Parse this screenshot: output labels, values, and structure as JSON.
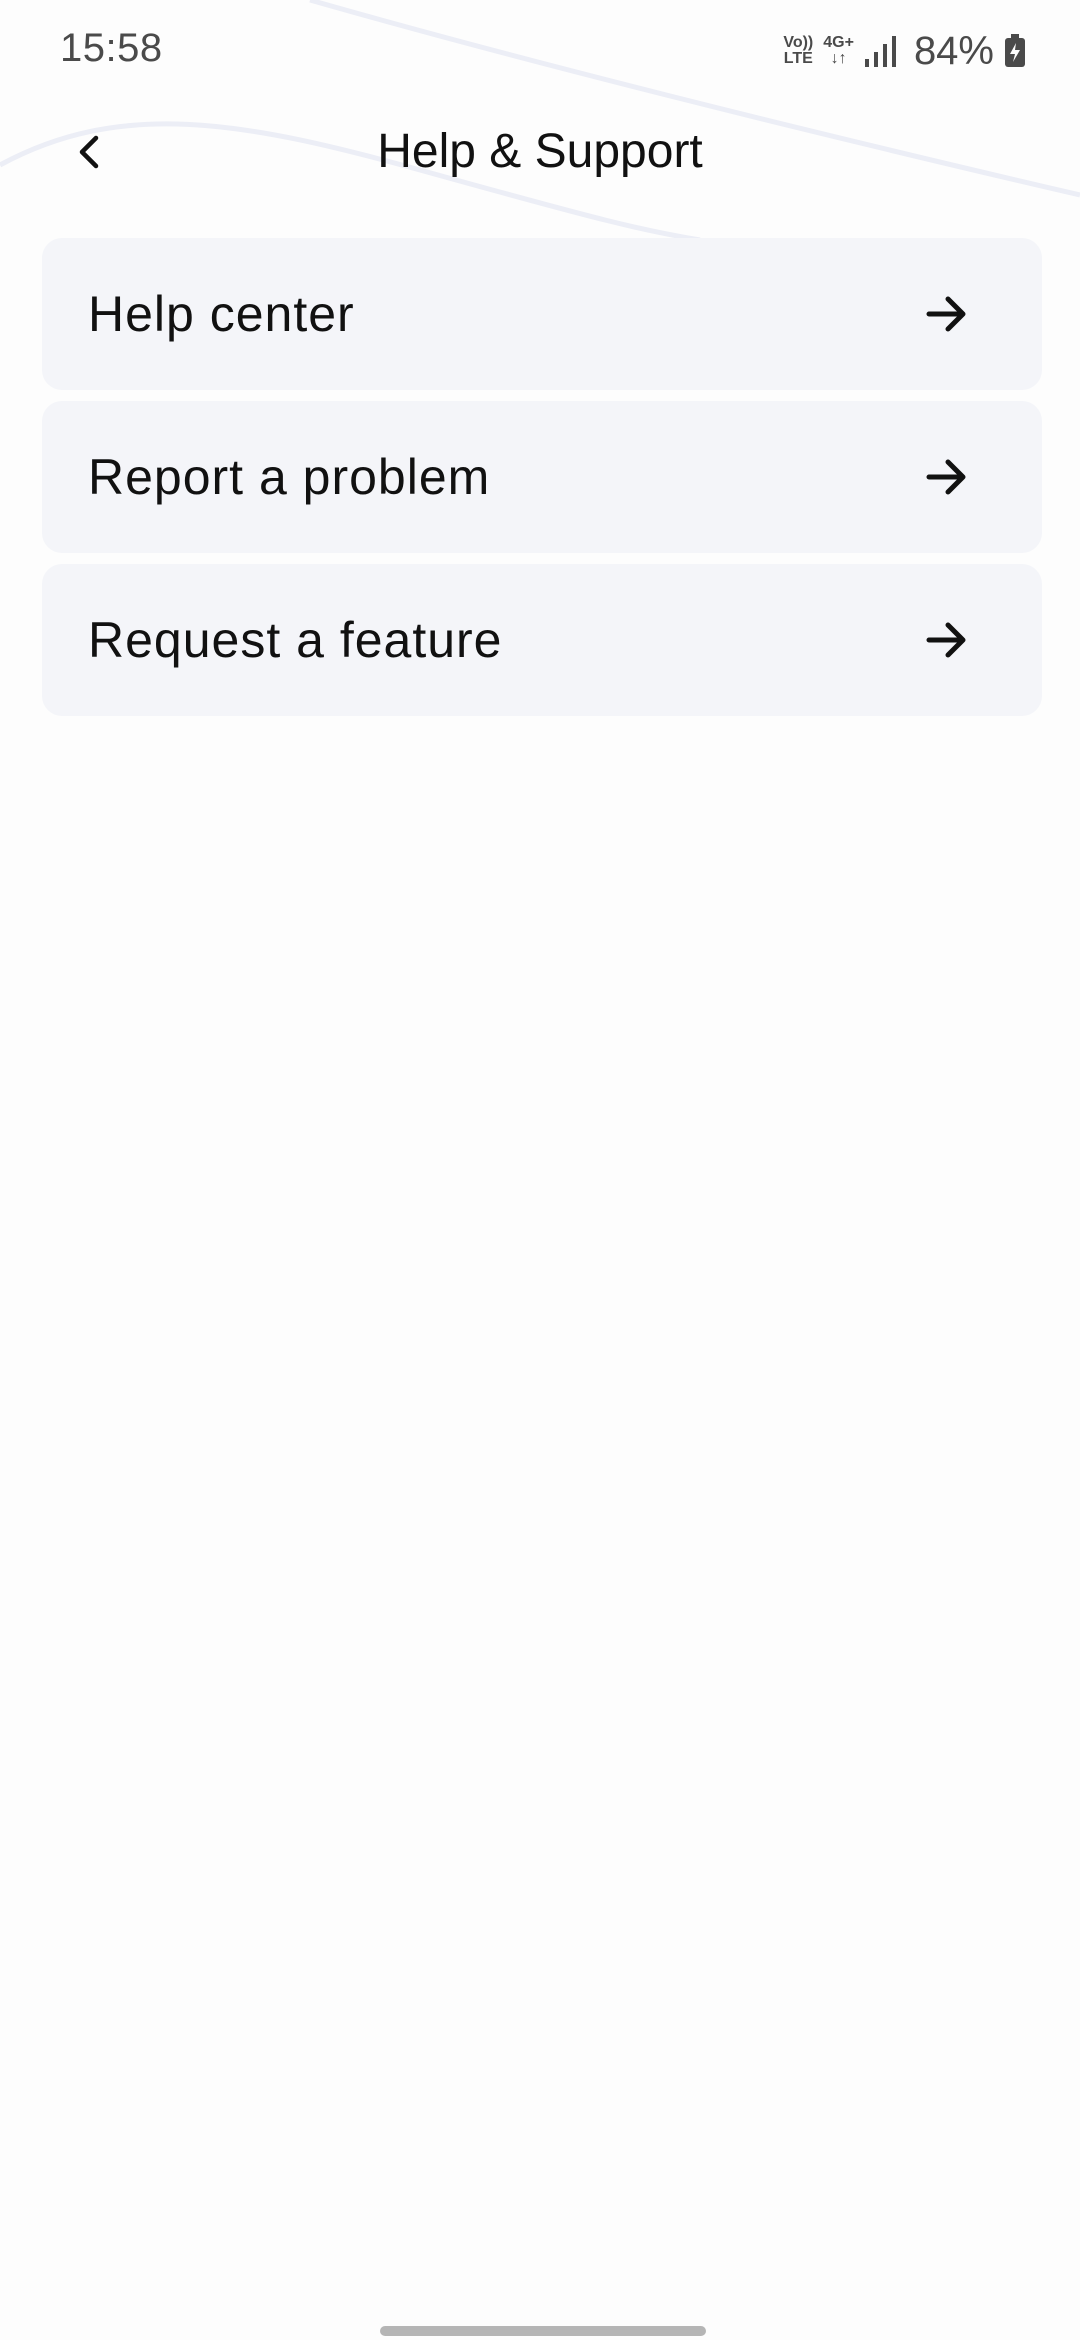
{
  "status_bar": {
    "time": "15:58",
    "volte_top": "Vo))",
    "volte_bottom": "LTE",
    "network_top": "4G+",
    "network_bottom": "↓↑",
    "battery": "84%"
  },
  "header": {
    "title": "Help & Support",
    "back_icon": "chevron-left-icon"
  },
  "menu": {
    "items": [
      {
        "label": "Help center",
        "icon": "arrow-right-icon"
      },
      {
        "label": "Report a problem",
        "icon": "arrow-right-icon"
      },
      {
        "label": "Request a feature",
        "icon": "arrow-right-icon"
      }
    ]
  },
  "colors": {
    "background": "#fdfdfd",
    "card": "#f4f5f9",
    "text": "#111111",
    "status_text": "#4a4a4a"
  }
}
